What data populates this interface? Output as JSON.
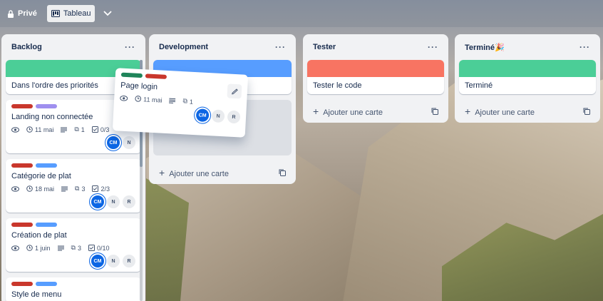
{
  "topbar": {
    "privacy_label": "Privé",
    "view_label": "Tableau"
  },
  "colors": {
    "green": "#4bce97",
    "blue": "#579dff",
    "red": "#f87462",
    "label_red": "#c9372c",
    "label_purple": "#9f8fef",
    "label_green": "#1f845a",
    "label_blue": "#579dff"
  },
  "lists": [
    {
      "title": "Backlog",
      "cards": [
        {
          "title": "Dans l'ordre des priorités",
          "cover": "green"
        },
        {
          "title": "Landing non connectée",
          "due": "11 mai",
          "attachments": "1",
          "checklist": "0/3",
          "members": [
            "CM",
            "N"
          ]
        },
        {
          "title": "Catégorie de plat",
          "due": "18 mai",
          "attachments": "3",
          "checklist": "2/3",
          "members": [
            "CM",
            "N",
            "R"
          ]
        },
        {
          "title": "Création de plat",
          "due": "1 juin",
          "attachments": "3",
          "checklist": "0/10",
          "members": [
            "CM",
            "N",
            "R"
          ]
        },
        {
          "title": "Style de menu"
        }
      ]
    },
    {
      "title": "Development",
      "add_label": "Ajouter une carte"
    },
    {
      "title": "Tester",
      "cards": [
        {
          "title": "Tester le code",
          "cover": "red"
        }
      ],
      "add_label": "Ajouter une carte"
    },
    {
      "title": "Terminé🎉",
      "cards": [
        {
          "title": "Terminé",
          "cover": "green"
        }
      ],
      "add_label": "Ajouter une carte"
    }
  ],
  "dragging_card": {
    "title": "Page login",
    "due": "11 mai",
    "attachments": "1",
    "members": [
      "CM",
      "N",
      "R"
    ]
  }
}
